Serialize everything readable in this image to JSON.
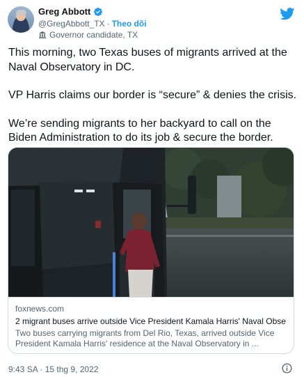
{
  "author": {
    "display_name": "Greg Abbott",
    "handle": "@GregAbbott_TX",
    "separator": "·",
    "follow_label": "Theo dõi",
    "label": "Governor candidate, TX"
  },
  "tweet": {
    "paragraphs": [
      "This morning, two Texas buses of migrants arrived at the Naval Observatory in DC.",
      "VP Harris claims our border is “secure” & denies the crisis.",
      "We’re sending migrants to her backyard to call on the Biden Administration to do its job & secure the border."
    ],
    "timestamp": "9:43 SA · 15 thg 9, 2022"
  },
  "card": {
    "domain": "foxnews.com",
    "title": "2 migrant buses arrive outside Vice President Kamala Harris' Naval Obse...",
    "description": "Two buses carrying migrants from Del Rio, Texas, arrived outside Vice President Kamala Harris' residence at the Naval Observatory in ..."
  },
  "colors": {
    "accent": "#1d9bf0",
    "text": "#0f1419",
    "muted": "#536471",
    "border": "#cfd9de"
  },
  "icons": [
    "verified-badge-icon",
    "government-label-icon",
    "twitter-bird-icon",
    "info-icon"
  ]
}
